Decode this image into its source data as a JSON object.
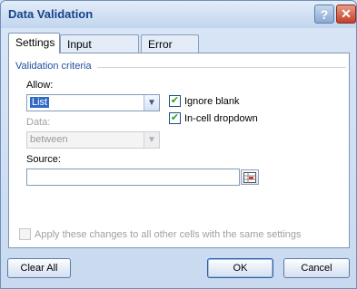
{
  "window": {
    "title": "Data Validation"
  },
  "titlebar": {
    "help_glyph": "?",
    "close_glyph": "✕"
  },
  "tabs": [
    {
      "label": "Settings",
      "active": true
    },
    {
      "label": "Input Message",
      "active": false
    },
    {
      "label": "Error Alert",
      "active": false
    }
  ],
  "criteria": {
    "group_title": "Validation criteria",
    "allow_label": "Allow:",
    "allow_value": "List",
    "data_label": "Data:",
    "data_value": "between",
    "ignore_blank_label": "Ignore blank",
    "ignore_blank_checked": true,
    "in_cell_dropdown_label": "In-cell dropdown",
    "in_cell_dropdown_checked": true,
    "source_label": "Source:",
    "source_value": ""
  },
  "apply_all": {
    "label": "Apply these changes to all other cells with the same settings",
    "checked": false
  },
  "buttons": {
    "clear_all": "Clear All",
    "ok": "OK",
    "cancel": "Cancel"
  },
  "icons": {
    "dropdown": "chevron-down-icon",
    "check": "checkmark-icon",
    "ref": "range-selector-icon"
  }
}
